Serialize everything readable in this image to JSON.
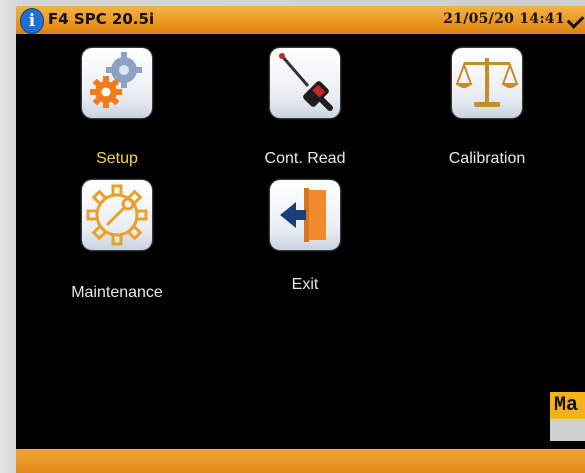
{
  "header": {
    "info_icon_glyph": "i",
    "title": "F4 SPC 20.5i",
    "datetime": "21/05/20 14:41",
    "accent_color": "#e8961d"
  },
  "menu": {
    "items": [
      {
        "label": "Setup",
        "icon": "gear-icon",
        "selected": true
      },
      {
        "label": "Cont. Read",
        "icon": "probe-icon",
        "selected": false
      },
      {
        "label": "Calibration",
        "icon": "balance-scale-icon",
        "selected": false
      },
      {
        "label": "Maintenance",
        "icon": "wrench-gear-icon",
        "selected": false
      },
      {
        "label": "Exit",
        "icon": "exit-door-icon",
        "selected": false
      }
    ]
  },
  "message": {
    "partial_text": "Ma"
  }
}
